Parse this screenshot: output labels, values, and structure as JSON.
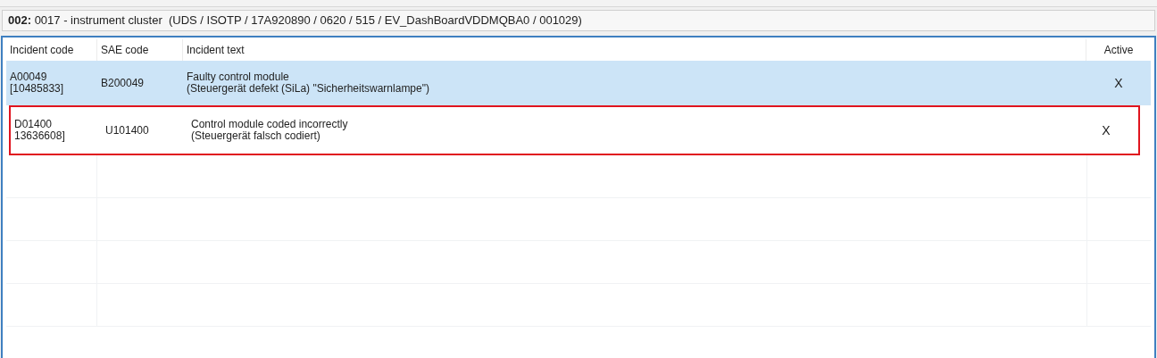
{
  "header": {
    "title": "**002:** 0017 - instrument cluster  (UDS / ISOTP / 17A920890 / 0620 / 515 / EV_DashBoardVDDMQBA0 / 001029)"
  },
  "table": {
    "columns": [
      "Incident code",
      "SAE code",
      "Incident text",
      "Active"
    ],
    "rows": [
      {
        "incident_code": [
          "A00049",
          "[10485833]"
        ],
        "sae_code": "B200049",
        "incident_text": [
          "Faulty control module",
          "(Steuergerät defekt (SiLa) \"Sicherheitswarnlampe\")"
        ],
        "active": "X",
        "selected": true,
        "highlighted": false
      },
      {
        "incident_code": [
          "D01400",
          "13636608]"
        ],
        "sae_code": "U101400",
        "incident_text": [
          "Control module coded incorrectly",
          "(Steuergerät falsch codiert)"
        ],
        "active": "X",
        "selected": false,
        "highlighted": true
      }
    ]
  }
}
